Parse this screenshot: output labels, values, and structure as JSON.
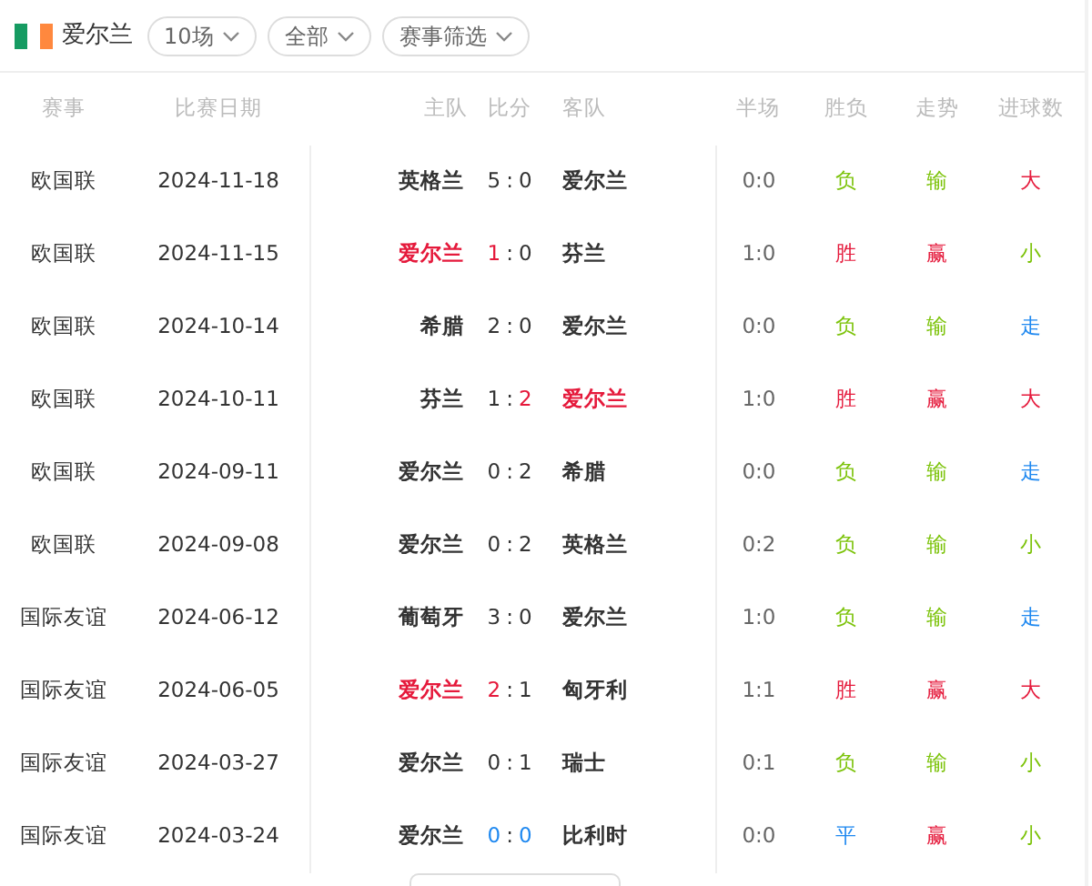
{
  "team": {
    "name": "爱尔兰"
  },
  "filters": [
    {
      "label": "10场"
    },
    {
      "label": "全部"
    },
    {
      "label": "赛事筛选"
    }
  ],
  "columns": [
    "赛事",
    "比赛日期",
    "主队",
    "比分",
    "客队",
    "半场",
    "胜负",
    "走势",
    "进球数"
  ],
  "rows": [
    {
      "competition": "欧国联",
      "date": "2024-11-18",
      "home": {
        "name": "英格兰",
        "highlighted": false
      },
      "home_score": {
        "text": "5",
        "color": "#333333"
      },
      "separator": ":",
      "away_score": {
        "text": "0",
        "color": "#333333"
      },
      "away": {
        "name": "爱尔兰",
        "highlighted": false
      },
      "half": "0:0",
      "result": {
        "text": "负",
        "color": "#7cc30a"
      },
      "trend": {
        "text": "输",
        "color": "#7cc30a"
      },
      "goals": {
        "text": "大",
        "color": "#e5193b"
      }
    },
    {
      "competition": "欧国联",
      "date": "2024-11-15",
      "home": {
        "name": "爱尔兰",
        "highlighted": true
      },
      "home_score": {
        "text": "1",
        "color": "#e5193b"
      },
      "separator": ":",
      "away_score": {
        "text": "0",
        "color": "#333333"
      },
      "away": {
        "name": "芬兰",
        "highlighted": false
      },
      "half": "1:0",
      "result": {
        "text": "胜",
        "color": "#e5193b"
      },
      "trend": {
        "text": "赢",
        "color": "#e5193b"
      },
      "goals": {
        "text": "小",
        "color": "#7cc30a"
      }
    },
    {
      "competition": "欧国联",
      "date": "2024-10-14",
      "home": {
        "name": "希腊",
        "highlighted": false
      },
      "home_score": {
        "text": "2",
        "color": "#333333"
      },
      "separator": ":",
      "away_score": {
        "text": "0",
        "color": "#333333"
      },
      "away": {
        "name": "爱尔兰",
        "highlighted": false
      },
      "half": "0:0",
      "result": {
        "text": "负",
        "color": "#7cc30a"
      },
      "trend": {
        "text": "输",
        "color": "#7cc30a"
      },
      "goals": {
        "text": "走",
        "color": "#1e88f0"
      }
    },
    {
      "competition": "欧国联",
      "date": "2024-10-11",
      "home": {
        "name": "芬兰",
        "highlighted": false
      },
      "home_score": {
        "text": "1",
        "color": "#333333"
      },
      "separator": ":",
      "away_score": {
        "text": "2",
        "color": "#e5193b"
      },
      "away": {
        "name": "爱尔兰",
        "highlighted": true
      },
      "half": "1:0",
      "result": {
        "text": "胜",
        "color": "#e5193b"
      },
      "trend": {
        "text": "赢",
        "color": "#e5193b"
      },
      "goals": {
        "text": "大",
        "color": "#e5193b"
      }
    },
    {
      "competition": "欧国联",
      "date": "2024-09-11",
      "home": {
        "name": "爱尔兰",
        "highlighted": false
      },
      "home_score": {
        "text": "0",
        "color": "#333333"
      },
      "separator": ":",
      "away_score": {
        "text": "2",
        "color": "#333333"
      },
      "away": {
        "name": "希腊",
        "highlighted": false
      },
      "half": "0:0",
      "result": {
        "text": "负",
        "color": "#7cc30a"
      },
      "trend": {
        "text": "输",
        "color": "#7cc30a"
      },
      "goals": {
        "text": "走",
        "color": "#1e88f0"
      }
    },
    {
      "competition": "欧国联",
      "date": "2024-09-08",
      "home": {
        "name": "爱尔兰",
        "highlighted": false
      },
      "home_score": {
        "text": "0",
        "color": "#333333"
      },
      "separator": ":",
      "away_score": {
        "text": "2",
        "color": "#333333"
      },
      "away": {
        "name": "英格兰",
        "highlighted": false
      },
      "half": "0:2",
      "result": {
        "text": "负",
        "color": "#7cc30a"
      },
      "trend": {
        "text": "输",
        "color": "#7cc30a"
      },
      "goals": {
        "text": "小",
        "color": "#7cc30a"
      }
    },
    {
      "competition": "国际友谊",
      "date": "2024-06-12",
      "home": {
        "name": "葡萄牙",
        "highlighted": false
      },
      "home_score": {
        "text": "3",
        "color": "#333333"
      },
      "separator": ":",
      "away_score": {
        "text": "0",
        "color": "#333333"
      },
      "away": {
        "name": "爱尔兰",
        "highlighted": false
      },
      "half": "1:0",
      "result": {
        "text": "负",
        "color": "#7cc30a"
      },
      "trend": {
        "text": "输",
        "color": "#7cc30a"
      },
      "goals": {
        "text": "走",
        "color": "#1e88f0"
      }
    },
    {
      "competition": "国际友谊",
      "date": "2024-06-05",
      "home": {
        "name": "爱尔兰",
        "highlighted": true
      },
      "home_score": {
        "text": "2",
        "color": "#e5193b"
      },
      "separator": ":",
      "away_score": {
        "text": "1",
        "color": "#333333"
      },
      "away": {
        "name": "匈牙利",
        "highlighted": false
      },
      "half": "1:1",
      "result": {
        "text": "胜",
        "color": "#e5193b"
      },
      "trend": {
        "text": "赢",
        "color": "#e5193b"
      },
      "goals": {
        "text": "大",
        "color": "#e5193b"
      }
    },
    {
      "competition": "国际友谊",
      "date": "2024-03-27",
      "home": {
        "name": "爱尔兰",
        "highlighted": false
      },
      "home_score": {
        "text": "0",
        "color": "#333333"
      },
      "separator": ":",
      "away_score": {
        "text": "1",
        "color": "#333333"
      },
      "away": {
        "name": "瑞士",
        "highlighted": false
      },
      "half": "0:1",
      "result": {
        "text": "负",
        "color": "#7cc30a"
      },
      "trend": {
        "text": "输",
        "color": "#7cc30a"
      },
      "goals": {
        "text": "小",
        "color": "#7cc30a"
      }
    },
    {
      "competition": "国际友谊",
      "date": "2024-03-24",
      "home": {
        "name": "爱尔兰",
        "highlighted": false
      },
      "home_score": {
        "text": "0",
        "color": "#1e88f0"
      },
      "separator": ":",
      "away_score": {
        "text": "0",
        "color": "#1e88f0"
      },
      "away": {
        "name": "比利时",
        "highlighted": false
      },
      "half": "0:0",
      "result": {
        "text": "平",
        "color": "#1e88f0"
      },
      "trend": {
        "text": "赢",
        "color": "#e5193b"
      },
      "goals": {
        "text": "小",
        "color": "#7cc30a"
      }
    }
  ]
}
